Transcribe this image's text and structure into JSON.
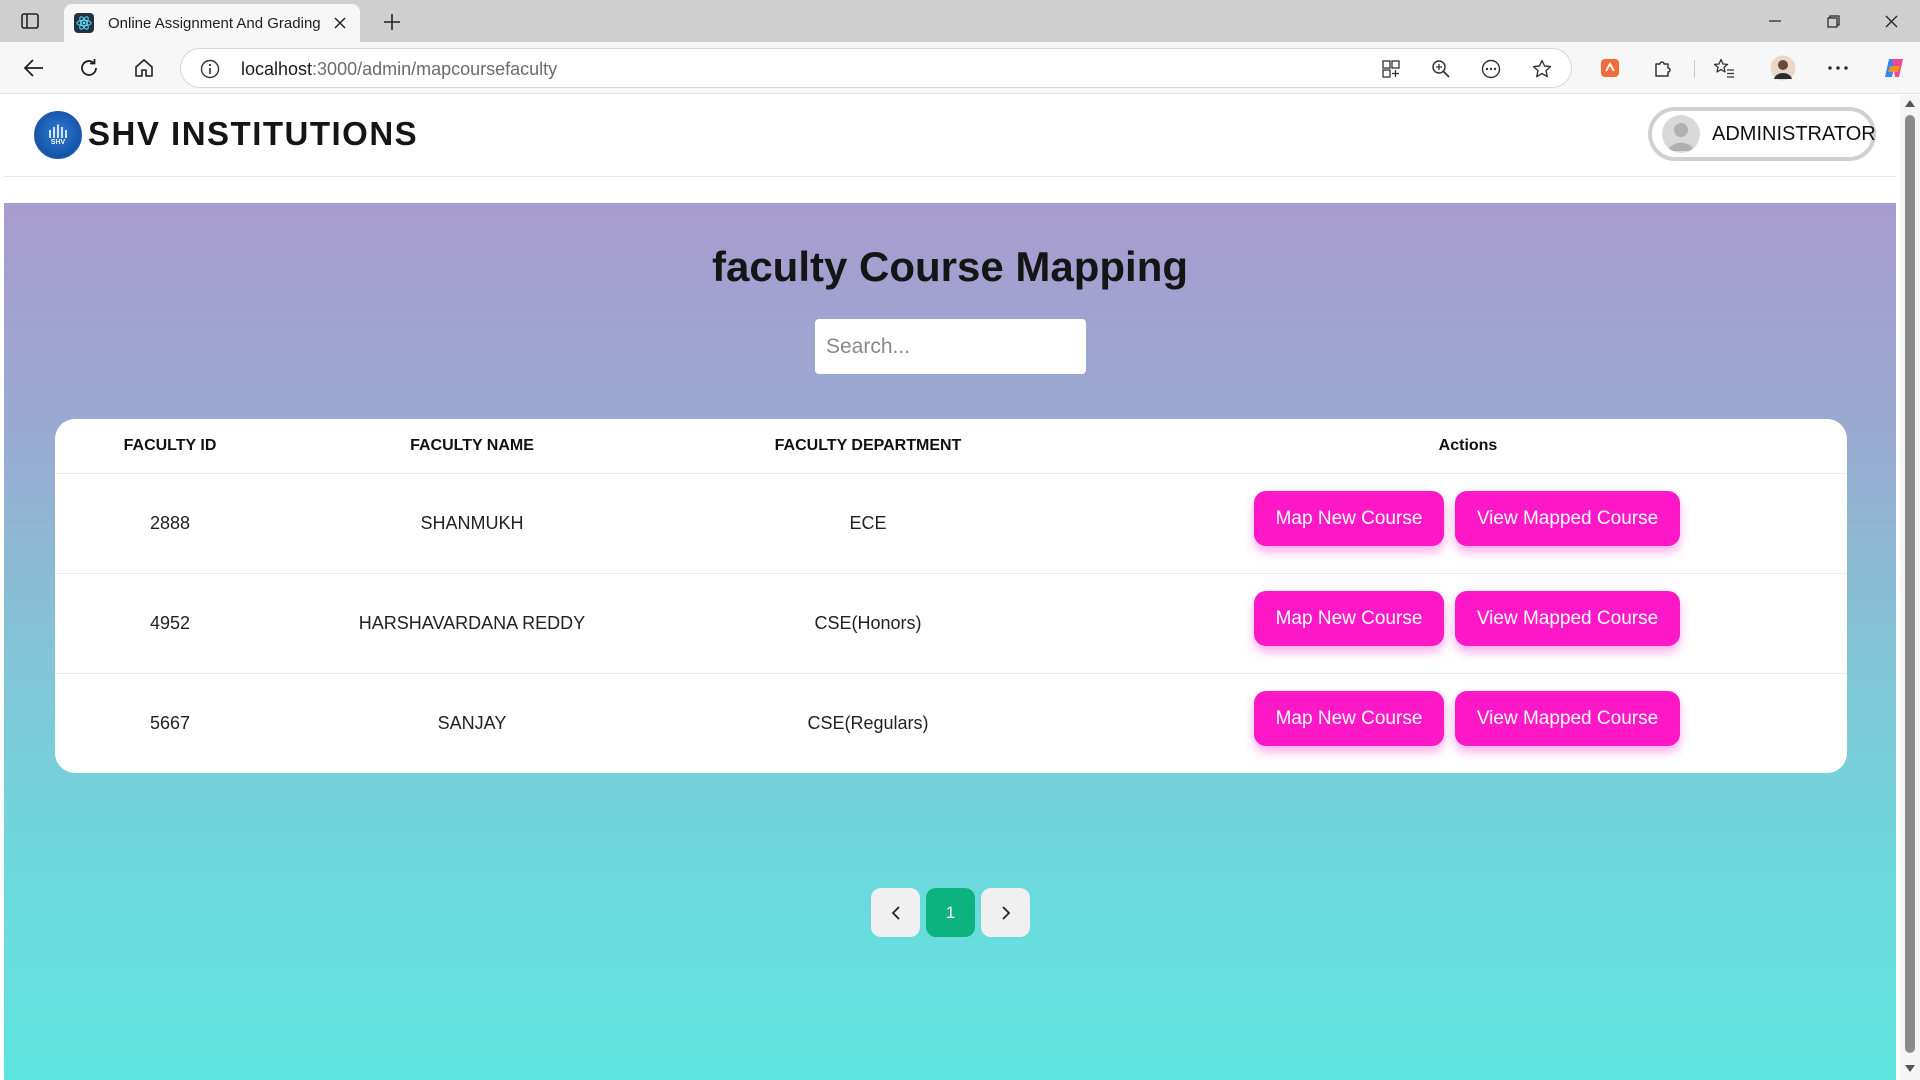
{
  "browser": {
    "tab_title": "Online Assignment And Grading System",
    "url_host": "localhost",
    "url_path": ":3000/admin/mapcoursefaculty"
  },
  "header": {
    "logo_text": "SHV",
    "brand": "SHV INSTITUTIONS",
    "user_label": "ADMINISTRATOR"
  },
  "main": {
    "title": "faculty Course Mapping",
    "search_placeholder": "Search...",
    "table": {
      "columns": [
        "FACULTY ID",
        "FACULTY NAME",
        "FACULTY DEPARTMENT",
        "Actions"
      ],
      "rows": [
        {
          "id": "2888",
          "name": "SHANMUKH",
          "department": "ECE",
          "map_label": "Map New Course",
          "view_label": "View Mapped Course"
        },
        {
          "id": "4952",
          "name": "HARSHAVARDANA REDDY",
          "department": "CSE(Honors)",
          "map_label": "Map New Course",
          "view_label": "View Mapped Course"
        },
        {
          "id": "5667",
          "name": "SANJAY",
          "department": "CSE(Regulars)",
          "map_label": "Map New Course",
          "view_label": "View Mapped Course"
        }
      ]
    },
    "pagination": {
      "current_page": "1"
    }
  },
  "colors": {
    "action_button": "#ff18c8",
    "active_page": "#0db37f",
    "gradient_top": "#a89ccf",
    "gradient_bottom": "#5fe5df"
  },
  "icons": {
    "tab_favicon": "react-icon",
    "pager_prev": "chevron-left-icon",
    "pager_next": "chevron-right-icon",
    "user": "user-avatar-icon"
  }
}
